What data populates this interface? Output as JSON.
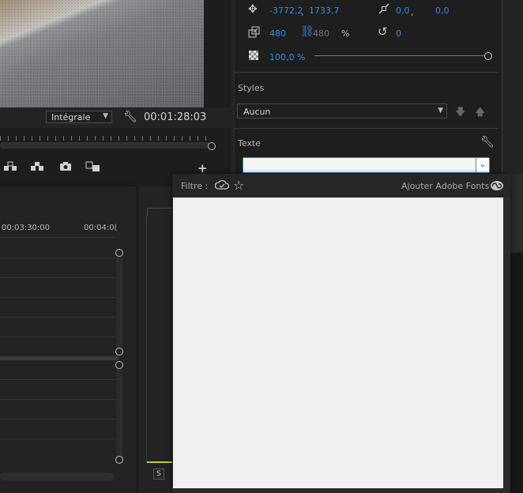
{
  "monitor": {
    "fit_value": "Intégrale",
    "timecode": "00:01:28:03"
  },
  "timeline": {
    "ruler_tc_1": "00:03:30:00",
    "ruler_tc_2": "00:04:0("
  },
  "transform": {
    "position_x": "-3772,2",
    "position_sep": ",",
    "position_y": "1733,7",
    "anchor_x": "0,0",
    "anchor_sep": ",",
    "anchor_y": "0,0",
    "scale_w": "480",
    "scale_h": "480",
    "scale_unit": "%",
    "rotation": "0",
    "opacity": "100,0 %",
    "opacity_level": 1.0
  },
  "styles": {
    "label": "Styles",
    "value": "Aucun"
  },
  "text_section": {
    "label": "Texte",
    "font_value": ""
  },
  "font_popup": {
    "filter_label": "Filtre :",
    "add_fonts_label": "Ajouter Adobe Fonts :"
  },
  "audio": {
    "solo_label": "S"
  },
  "colors": {
    "accent_blue": "#2d8ceb",
    "panel_bg": "#232323",
    "meter_yellow": "#c9c93a"
  }
}
